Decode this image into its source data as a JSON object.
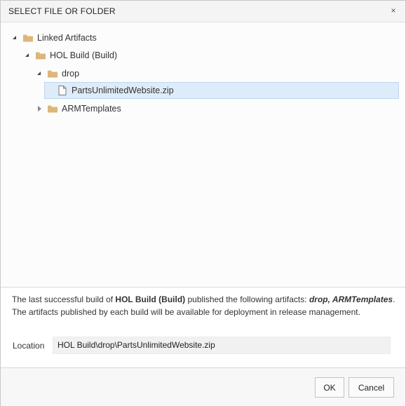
{
  "dialog": {
    "title": "SELECT FILE OR FOLDER",
    "close_glyph": "×"
  },
  "tree": {
    "nodes": [
      {
        "label": "Linked Artifacts",
        "type": "folder",
        "state": "expanded"
      },
      {
        "label": "HOL Build (Build)",
        "type": "folder",
        "state": "expanded"
      },
      {
        "label": "drop",
        "type": "folder",
        "state": "expanded"
      },
      {
        "label": "PartsUnlimitedWebsite.zip",
        "type": "file",
        "selected": true
      },
      {
        "label": "ARMTemplates",
        "type": "folder",
        "state": "collapsed"
      }
    ]
  },
  "info": {
    "text_pre": "The last successful build of ",
    "build_name": "HOL Build (Build)",
    "text_mid": " published the following artifacts: ",
    "artifacts": "drop, ARMTemplates",
    "text_post": ". The artifacts published by each build will be available for deployment in release management."
  },
  "location": {
    "label": "Location",
    "value": "HOL Build\\drop\\PartsUnlimitedWebsite.zip"
  },
  "buttons": {
    "ok": "OK",
    "cancel": "Cancel"
  },
  "colors": {
    "selection": "#deecf9",
    "folder": "#dcb67a"
  }
}
